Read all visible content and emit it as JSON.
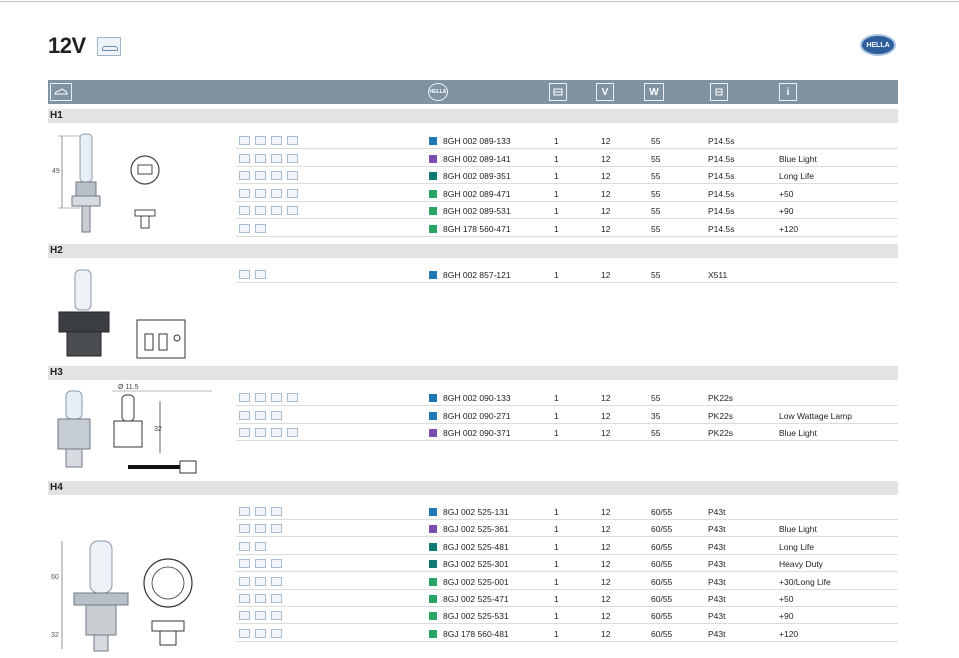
{
  "page": {
    "title": "12V",
    "brand": "HELLA"
  },
  "header": {
    "icons": [
      {
        "name": "car-icon",
        "text": ""
      },
      {
        "name": "hella-logo-icon",
        "text": "HELLA"
      },
      {
        "name": "package-icon",
        "text": ""
      },
      {
        "name": "volt-icon",
        "text": "V"
      },
      {
        "name": "watt-icon",
        "text": "W"
      },
      {
        "name": "base-icon",
        "text": ""
      },
      {
        "name": "info-icon",
        "text": "i"
      }
    ]
  },
  "colors": {
    "blue": "#1f77b4",
    "purple": "#7b4fb0",
    "teal": "#0f7a73",
    "green": "#2aa466",
    "header": "#7f93a3"
  },
  "sections": [
    {
      "name": "H1",
      "dims": [
        "49"
      ],
      "rows": [
        {
          "icons": 4,
          "color": "blue",
          "code": "8GH 002 089-133",
          "qty": "1",
          "volt": "12",
          "watt": "55",
          "base": "P14.5s",
          "note": ""
        },
        {
          "icons": 4,
          "color": "purple",
          "code": "8GH 002 089-141",
          "qty": "1",
          "volt": "12",
          "watt": "55",
          "base": "P14.5s",
          "note": "Blue Light"
        },
        {
          "icons": 4,
          "color": "teal",
          "code": "8GH 002 089-351",
          "qty": "1",
          "volt": "12",
          "watt": "55",
          "base": "P14.5s",
          "note": "Long Life"
        },
        {
          "icons": 4,
          "color": "green",
          "code": "8GH 002 089-471",
          "qty": "1",
          "volt": "12",
          "watt": "55",
          "base": "P14.5s",
          "note": "+50"
        },
        {
          "icons": 4,
          "color": "green",
          "code": "8GH 002 089-531",
          "qty": "1",
          "volt": "12",
          "watt": "55",
          "base": "P14.5s",
          "note": "+90"
        },
        {
          "icons": 2,
          "color": "green",
          "code": "8GH 178 560-471",
          "qty": "1",
          "volt": "12",
          "watt": "55",
          "base": "P14.5s",
          "note": "+120"
        }
      ]
    },
    {
      "name": "H2",
      "dims": [],
      "rows": [
        {
          "icons": 2,
          "color": "blue",
          "code": "8GH 002 857-121",
          "qty": "1",
          "volt": "12",
          "watt": "55",
          "base": "X511",
          "note": ""
        }
      ]
    },
    {
      "name": "H3",
      "dims": [
        "Ø 11.5",
        "32"
      ],
      "rows": [
        {
          "icons": 4,
          "color": "blue",
          "code": "8GH 002 090-133",
          "qty": "1",
          "volt": "12",
          "watt": "55",
          "base": "PK22s",
          "note": ""
        },
        {
          "icons": 3,
          "color": "blue",
          "code": "8GH 002 090-271",
          "qty": "1",
          "volt": "12",
          "watt": "35",
          "base": "PK22s",
          "note": "Low Wattage Lamp"
        },
        {
          "icons": 4,
          "color": "purple",
          "code": "8GH 002 090-371",
          "qty": "1",
          "volt": "12",
          "watt": "55",
          "base": "PK22s",
          "note": "Blue Light"
        }
      ]
    },
    {
      "name": "H4",
      "dims": [
        "60",
        "32"
      ],
      "rows": [
        {
          "icons": 3,
          "color": "blue",
          "code": "8GJ 002 525-131",
          "qty": "1",
          "volt": "12",
          "watt": "60/55",
          "base": "P43t",
          "note": ""
        },
        {
          "icons": 3,
          "color": "purple",
          "code": "8GJ 002 525-361",
          "qty": "1",
          "volt": "12",
          "watt": "60/55",
          "base": "P43t",
          "note": "Blue Light"
        },
        {
          "icons": 2,
          "color": "teal",
          "code": "8GJ 002 525-481",
          "qty": "1",
          "volt": "12",
          "watt": "60/55",
          "base": "P43t",
          "note": "Long Life"
        },
        {
          "icons": 3,
          "color": "teal",
          "code": "8GJ 002 525-301",
          "qty": "1",
          "volt": "12",
          "watt": "60/55",
          "base": "P43t",
          "note": "Heavy Duty"
        },
        {
          "icons": 3,
          "color": "green",
          "code": "8GJ 002 525-001",
          "qty": "1",
          "volt": "12",
          "watt": "60/55",
          "base": "P43t",
          "note": "+30/Long Life"
        },
        {
          "icons": 3,
          "color": "green",
          "code": "8GJ 002 525-471",
          "qty": "1",
          "volt": "12",
          "watt": "60/55",
          "base": "P43t",
          "note": "+50"
        },
        {
          "icons": 3,
          "color": "green",
          "code": "8GJ 002 525-531",
          "qty": "1",
          "volt": "12",
          "watt": "60/55",
          "base": "P43t",
          "note": "+90"
        },
        {
          "icons": 3,
          "color": "green",
          "code": "8GJ 178 560-481",
          "qty": "1",
          "volt": "12",
          "watt": "60/55",
          "base": "P43t",
          "note": "+120"
        }
      ]
    }
  ]
}
